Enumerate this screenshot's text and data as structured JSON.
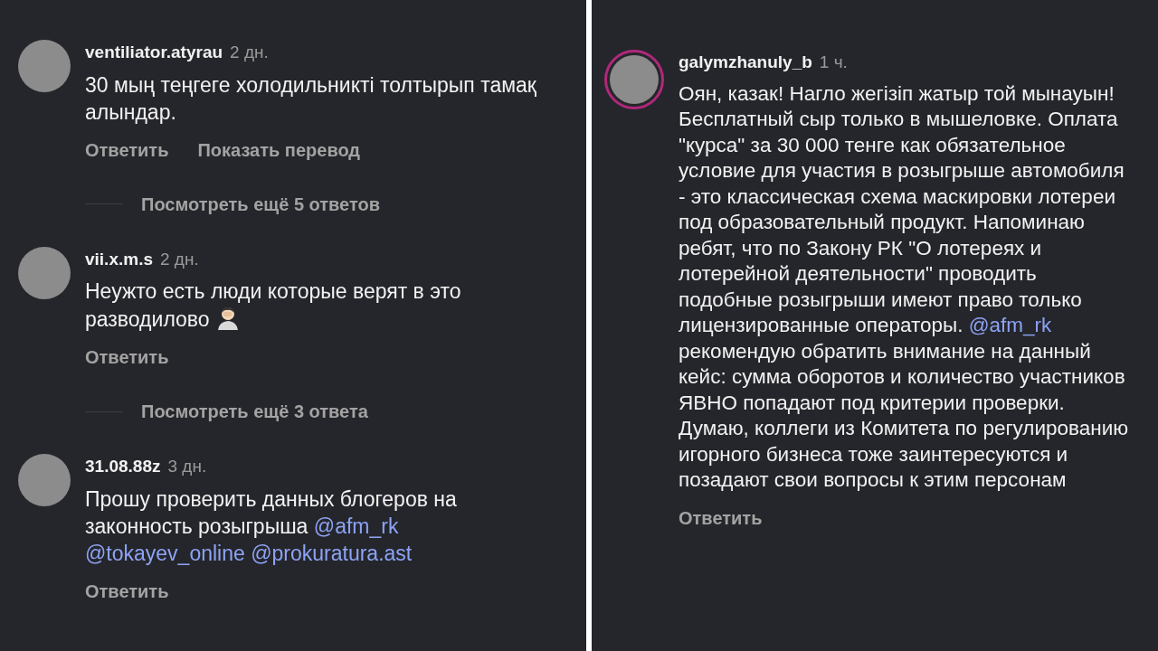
{
  "panels": [
    {
      "items": [
        {
          "kind": "comment",
          "username": "ventiliator.atyrau",
          "time": "2 дн.",
          "story_ring": false,
          "segments": [
            {
              "kind": "text",
              "text": "30 мың теңгеге холодильникті толтырып тамақ алындар."
            }
          ],
          "actions": [
            "Ответить",
            "Показать перевод"
          ]
        },
        {
          "kind": "more",
          "text": "Посмотреть ещё 5 ответов"
        },
        {
          "kind": "comment",
          "username": "vii.x.m.s",
          "time": "2 дн.",
          "story_ring": false,
          "segments": [
            {
              "kind": "text",
              "text": "Неужто есть люди которые верят в это разводилово "
            },
            {
              "kind": "emoji"
            }
          ],
          "actions": [
            "Ответить"
          ]
        },
        {
          "kind": "more",
          "text": "Посмотреть ещё 3 ответа"
        },
        {
          "kind": "comment",
          "username": "31.08.88z",
          "time": "3 дн.",
          "story_ring": false,
          "segments": [
            {
              "kind": "text",
              "text": "Прошу проверить данных блогеров на законность розыгрыша "
            },
            {
              "kind": "mention",
              "text": "@afm_rk"
            },
            {
              "kind": "mention",
              "text": "@tokayev_online"
            },
            {
              "kind": "mention",
              "text": "@prokuratura.ast"
            }
          ],
          "actions": [
            "Ответить"
          ]
        }
      ]
    },
    {
      "items": [
        {
          "kind": "comment",
          "username": "galymzhanuly_b",
          "time": "1 ч.",
          "story_ring": true,
          "segments": [
            {
              "kind": "text",
              "text": "Оян, казак! Нагло жегізіп жатыр той мынауын! Бесплатный сыр только в мышеловке. Оплата \"курса\" за 30 000 тенге как обязательное условие для участия в розыгрыше автомобиля - это классическая схема маскировки лотереи под образовательный продукт. Напоминаю ребят, что по Закону РК \"О лотереях и лотерейной деятельности\" проводить подобные розыгрыши имеют право только лицензированные операторы. "
            },
            {
              "kind": "mention",
              "text": "@afm_rk"
            },
            {
              "kind": "text",
              "text": " рекомендую обратить внимание на данный кейс: сумма оборотов и количество участников ЯВНО попадают под критерии проверки. Думаю, коллеги из Комитета по регулированию игорного бизнеса тоже заинтересуются и позадают свои вопросы к этим персонам"
            }
          ],
          "actions": [
            "Ответить"
          ]
        }
      ]
    }
  ]
}
